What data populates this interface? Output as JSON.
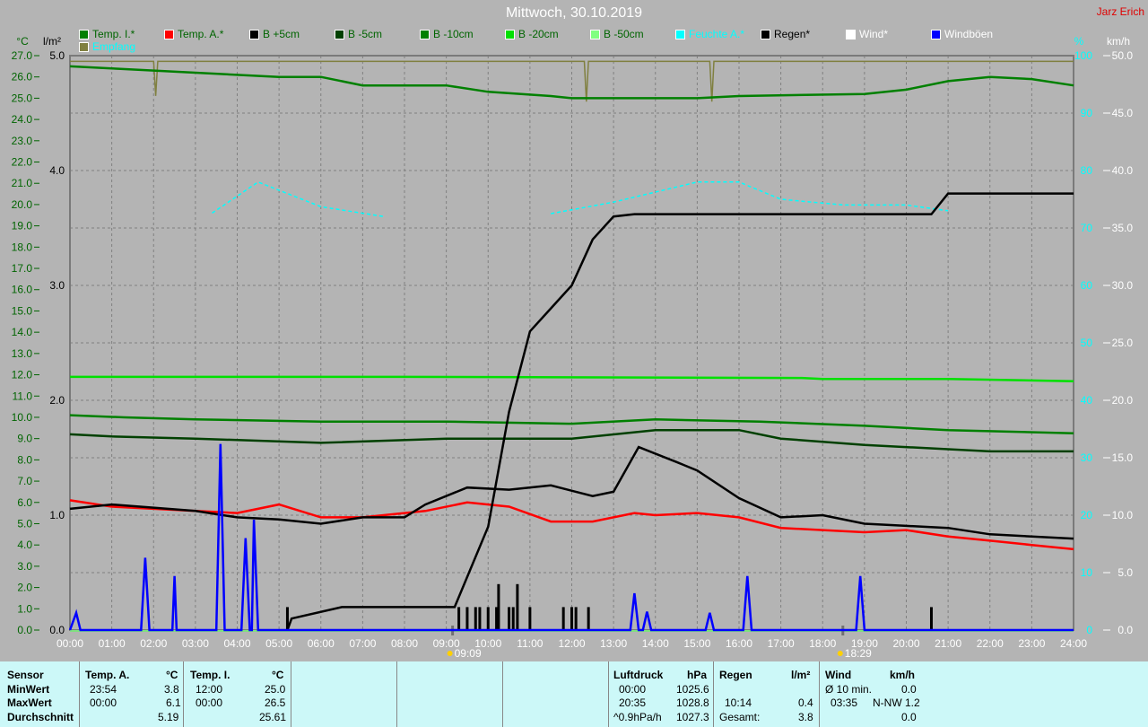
{
  "title": "Mittwoch, 30.10.2019",
  "author": "Jarz Erich",
  "legend": [
    {
      "label": "Temp. I.*",
      "color": "#008000",
      "text": "#006400"
    },
    {
      "label": "Temp. A.*",
      "color": "#ff0000",
      "text": "#006400"
    },
    {
      "label": "B +5cm",
      "color": "#000000",
      "text": "#006400"
    },
    {
      "label": "B -5cm",
      "color": "#004000",
      "text": "#006400"
    },
    {
      "label": "B -10cm",
      "color": "#008000",
      "text": "#006400"
    },
    {
      "label": "B -20cm",
      "color": "#00e000",
      "text": "#006400"
    },
    {
      "label": "B -50cm",
      "color": "#80ff80",
      "text": "#006400"
    },
    {
      "label": "Feuchte A.*",
      "color": "#00ffff",
      "text": "#00ffff"
    },
    {
      "label": "Regen*",
      "color": "#000000",
      "text": "#000000"
    },
    {
      "label": "Wind*",
      "color": "#ffffff",
      "text": "#ffffff"
    },
    {
      "label": "Windböen",
      "color": "#0000ff",
      "text": "#ffffff"
    },
    {
      "label": "Empfang",
      "color": "#808040",
      "text": "#00ffff"
    }
  ],
  "chart_data": {
    "type": "line",
    "title": "Mittwoch, 30.10.2019",
    "x_unit": "hour",
    "xlim": [
      0,
      24
    ],
    "x_ticks": [
      "00:00",
      "01:00",
      "02:00",
      "03:00",
      "04:00",
      "05:00",
      "06:00",
      "07:00",
      "08:00",
      "09:00",
      "10:00",
      "11:00",
      "12:00",
      "13:00",
      "14:00",
      "15:00",
      "16:00",
      "17:00",
      "18:00",
      "19:00",
      "20:00",
      "21:00",
      "22:00",
      "23:00",
      "24:00"
    ],
    "axes": {
      "temp": {
        "label": "°C",
        "lim": [
          0,
          27
        ]
      },
      "rain": {
        "label": "l/m²",
        "lim": [
          0,
          5
        ]
      },
      "humidity": {
        "label": "%",
        "lim": [
          0,
          100
        ]
      },
      "wind": {
        "label": "km/h",
        "lim": [
          0,
          50
        ]
      }
    },
    "sunrise": "09:09",
    "sunset": "18:29",
    "series": [
      {
        "name": "Empfang",
        "axis": "humidity",
        "color": "#808040",
        "points": [
          [
            0,
            99
          ],
          [
            2,
            99
          ],
          [
            2.05,
            93
          ],
          [
            2.1,
            99
          ],
          [
            12.3,
            99
          ],
          [
            12.35,
            92
          ],
          [
            12.4,
            99
          ],
          [
            15.3,
            99
          ],
          [
            15.35,
            92
          ],
          [
            15.4,
            99
          ],
          [
            24,
            99
          ]
        ]
      },
      {
        "name": "Temp. I.*",
        "axis": "temp",
        "color": "#008000",
        "points": [
          [
            0,
            26.5
          ],
          [
            1,
            26.4
          ],
          [
            3,
            26.2
          ],
          [
            5,
            26.0
          ],
          [
            6,
            26.0
          ],
          [
            7,
            25.6
          ],
          [
            8,
            25.6
          ],
          [
            9,
            25.6
          ],
          [
            10,
            25.3
          ],
          [
            11.5,
            25.1
          ],
          [
            12,
            25.0
          ],
          [
            15,
            25.0
          ],
          [
            16,
            25.1
          ],
          [
            19,
            25.2
          ],
          [
            20,
            25.4
          ],
          [
            21,
            25.8
          ],
          [
            22,
            26.0
          ],
          [
            23,
            25.9
          ],
          [
            24,
            25.6
          ]
        ]
      },
      {
        "name": "B -20cm",
        "axis": "temp",
        "color": "#00e000",
        "points": [
          [
            0,
            11.9
          ],
          [
            8,
            11.9
          ],
          [
            17.5,
            11.85
          ],
          [
            18,
            11.8
          ],
          [
            21,
            11.8
          ],
          [
            24,
            11.7
          ]
        ]
      },
      {
        "name": "B -10cm",
        "axis": "temp",
        "color": "#008000",
        "points": [
          [
            0,
            10.1
          ],
          [
            1.3,
            10.0
          ],
          [
            3,
            9.9
          ],
          [
            6,
            9.8
          ],
          [
            9,
            9.8
          ],
          [
            12,
            9.7
          ],
          [
            14,
            9.9
          ],
          [
            16.5,
            9.8
          ],
          [
            19,
            9.6
          ],
          [
            21,
            9.4
          ],
          [
            24,
            9.25
          ]
        ]
      },
      {
        "name": "B -5cm",
        "axis": "temp",
        "color": "#004000",
        "points": [
          [
            0,
            9.2
          ],
          [
            1,
            9.1
          ],
          [
            3,
            9.0
          ],
          [
            6,
            8.8
          ],
          [
            9,
            9.0
          ],
          [
            12,
            9.0
          ],
          [
            14,
            9.4
          ],
          [
            16,
            9.4
          ],
          [
            17,
            9.0
          ],
          [
            19,
            8.7
          ],
          [
            21,
            8.5
          ],
          [
            22,
            8.4
          ],
          [
            24,
            8.4
          ]
        ]
      },
      {
        "name": "Temp. A.*",
        "axis": "temp",
        "color": "#ff0000",
        "points": [
          [
            0,
            6.1
          ],
          [
            1,
            5.8
          ],
          [
            3,
            5.6
          ],
          [
            4,
            5.5
          ],
          [
            5,
            5.9
          ],
          [
            6,
            5.3
          ],
          [
            7,
            5.3
          ],
          [
            8.5,
            5.6
          ],
          [
            9.5,
            6.0
          ],
          [
            10.5,
            5.8
          ],
          [
            11.5,
            5.1
          ],
          [
            12.5,
            5.1
          ],
          [
            13.5,
            5.5
          ],
          [
            14,
            5.4
          ],
          [
            15,
            5.5
          ],
          [
            16,
            5.3
          ],
          [
            17,
            4.8
          ],
          [
            18,
            4.7
          ],
          [
            19,
            4.6
          ],
          [
            20,
            4.7
          ],
          [
            21,
            4.4
          ],
          [
            22,
            4.2
          ],
          [
            23,
            4.0
          ],
          [
            24,
            3.8
          ]
        ]
      },
      {
        "name": "B +5cm",
        "axis": "temp",
        "color": "#000000",
        "points": [
          [
            0,
            5.7
          ],
          [
            1,
            5.9
          ],
          [
            3,
            5.6
          ],
          [
            4,
            5.3
          ],
          [
            5,
            5.2
          ],
          [
            6,
            5.0
          ],
          [
            7,
            5.3
          ],
          [
            8,
            5.3
          ],
          [
            8.5,
            5.9
          ],
          [
            9.5,
            6.7
          ],
          [
            10.5,
            6.6
          ],
          [
            11.5,
            6.8
          ],
          [
            12.5,
            6.3
          ],
          [
            13,
            6.5
          ],
          [
            13.6,
            8.6
          ],
          [
            14.5,
            7.9
          ],
          [
            15,
            7.5
          ],
          [
            16,
            6.2
          ],
          [
            17,
            5.3
          ],
          [
            18,
            5.4
          ],
          [
            19,
            5.0
          ],
          [
            20,
            4.9
          ],
          [
            21,
            4.8
          ],
          [
            22,
            4.5
          ],
          [
            23,
            4.4
          ],
          [
            24,
            4.3
          ]
        ]
      },
      {
        "name": "Feuchte A.*",
        "axis": "humidity",
        "color": "#00ffff",
        "dashed": true,
        "points": [
          [
            3.4,
            72.6
          ],
          [
            4.5,
            78
          ],
          [
            6,
            73.7
          ],
          [
            7.5,
            72
          ],
          null,
          [
            11.5,
            72.5
          ],
          [
            13,
            74.5
          ],
          [
            15,
            78
          ],
          [
            16,
            78
          ],
          [
            17,
            75
          ],
          [
            18.5,
            74
          ],
          [
            20,
            74
          ],
          [
            21,
            73
          ]
        ]
      },
      {
        "name": "Regen*",
        "axis": "rain",
        "color": "#000000",
        "points": [
          [
            5.2,
            0
          ],
          [
            5.3,
            0.1
          ],
          [
            6.5,
            0.2
          ],
          [
            9.2,
            0.2
          ],
          [
            10,
            0.9
          ],
          [
            10.5,
            1.9
          ],
          [
            11,
            2.6
          ],
          [
            11.5,
            2.8
          ],
          [
            12,
            3.0
          ],
          [
            12.5,
            3.4
          ],
          [
            13,
            3.6
          ],
          [
            13.5,
            3.62
          ],
          [
            20.6,
            3.62
          ],
          [
            21,
            3.8
          ],
          [
            24,
            3.8
          ]
        ]
      },
      {
        "name": "Windböen",
        "axis": "wind",
        "color": "#0000ff",
        "points": [
          [
            0,
            0
          ],
          [
            0.15,
            1.5
          ],
          [
            0.25,
            0
          ],
          [
            1.7,
            0
          ],
          [
            1.8,
            6.3
          ],
          [
            1.9,
            0
          ],
          [
            2.45,
            0
          ],
          [
            2.5,
            4.7
          ],
          [
            2.55,
            0
          ],
          [
            3.5,
            0
          ],
          [
            3.6,
            16.2
          ],
          [
            3.7,
            0
          ],
          [
            4.1,
            0
          ],
          [
            4.2,
            8.0
          ],
          [
            4.3,
            0
          ],
          [
            4.35,
            0
          ],
          [
            4.4,
            9.6
          ],
          [
            4.5,
            0
          ],
          [
            13.4,
            0
          ],
          [
            13.5,
            3.2
          ],
          [
            13.6,
            0
          ],
          [
            13.7,
            0
          ],
          [
            13.8,
            1.6
          ],
          [
            13.9,
            0
          ],
          [
            15.2,
            0
          ],
          [
            15.3,
            1.5
          ],
          [
            15.4,
            0
          ],
          [
            16.1,
            0
          ],
          [
            16.2,
            4.7
          ],
          [
            16.3,
            0
          ],
          [
            18.8,
            0
          ],
          [
            18.9,
            4.7
          ],
          [
            19.0,
            0
          ],
          [
            24,
            0
          ]
        ]
      }
    ],
    "rain_bars": {
      "axis": "rain",
      "color": "#000000",
      "points": [
        [
          5.2,
          0.2
        ],
        [
          9.3,
          0.2
        ],
        [
          9.5,
          0.2
        ],
        [
          9.7,
          0.2
        ],
        [
          9.8,
          0.2
        ],
        [
          10.0,
          0.2
        ],
        [
          10.2,
          0.2
        ],
        [
          10.25,
          0.4
        ],
        [
          10.5,
          0.2
        ],
        [
          10.6,
          0.2
        ],
        [
          10.7,
          0.4
        ],
        [
          11.0,
          0.2
        ],
        [
          11.8,
          0.2
        ],
        [
          12.0,
          0.2
        ],
        [
          12.1,
          0.2
        ],
        [
          12.4,
          0.2
        ],
        [
          20.6,
          0.2
        ]
      ]
    }
  },
  "table": {
    "sensor": {
      "h": "Sensor",
      "r1": "MinWert",
      "r2": "MaxWert",
      "r3": "Durchschnitt"
    },
    "tempA": {
      "h": "Temp. A.",
      "u": "°C",
      "t1": "23:54",
      "v1": "3.8",
      "t2": "00:00",
      "v2": "6.1",
      "v3": "5.19"
    },
    "tempI": {
      "h": "Temp. I.",
      "u": "°C",
      "t1": "12:00",
      "v1": "25.0",
      "t2": "00:00",
      "v2": "26.5",
      "v3": "25.61"
    },
    "pressure": {
      "h": "Luftdruck",
      "u": "hPa",
      "t1": "00:00",
      "v1": "1025.6",
      "t2": "20:35",
      "v2": "1028.8",
      "t3": "^0.9hPa/h",
      "v3": "1027.3"
    },
    "rain": {
      "h": "Regen",
      "u": "l/m²",
      "t2": "10:14",
      "v2": "0.4",
      "t3": "Gesamt:",
      "v3": "3.8"
    },
    "wind": {
      "h": "Wind",
      "u": "km/h",
      "t1": "Ø 10 min.",
      "v1": "0.0",
      "t2": "03:35",
      "v2": "N-NW 1.2",
      "v3": "0.0"
    }
  }
}
